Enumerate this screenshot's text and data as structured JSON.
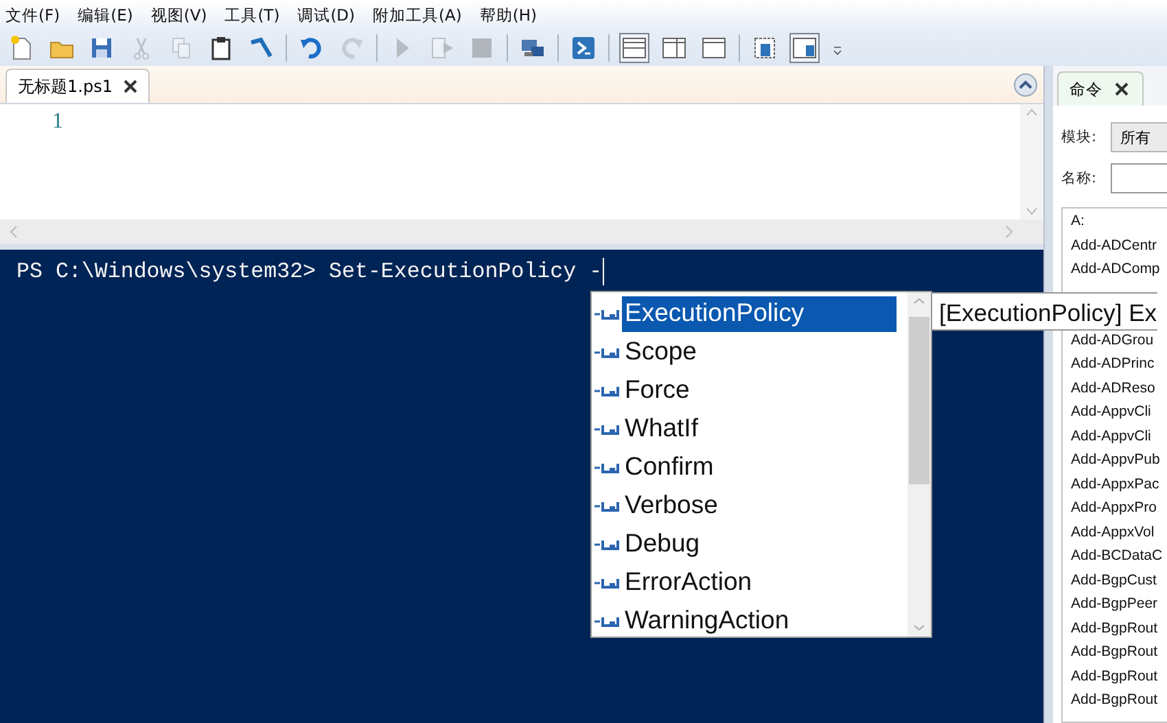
{
  "menu": [
    "文件(F)",
    "编辑(E)",
    "视图(V)",
    "工具(T)",
    "调试(D)",
    "附加工具(A)",
    "帮助(H)"
  ],
  "toolbar": [
    {
      "kind": "new",
      "disabled": false
    },
    {
      "kind": "open",
      "disabled": false
    },
    {
      "kind": "save",
      "disabled": false
    },
    {
      "kind": "cut",
      "disabled": true
    },
    {
      "kind": "copy",
      "disabled": true
    },
    {
      "kind": "paste",
      "disabled": false
    },
    {
      "kind": "clear",
      "disabled": false
    },
    {
      "kind": "separator"
    },
    {
      "kind": "undo",
      "disabled": false
    },
    {
      "kind": "redo",
      "disabled": true
    },
    {
      "kind": "separator"
    },
    {
      "kind": "run",
      "disabled": true
    },
    {
      "kind": "runselection",
      "disabled": true
    },
    {
      "kind": "stop",
      "disabled": true
    },
    {
      "kind": "separator"
    },
    {
      "kind": "remote",
      "disabled": false
    },
    {
      "kind": "separator"
    },
    {
      "kind": "console",
      "disabled": false
    },
    {
      "kind": "separator"
    },
    {
      "kind": "layouttop",
      "selected": true
    },
    {
      "kind": "layoutright",
      "selected": false
    },
    {
      "kind": "layoutmax",
      "selected": false
    },
    {
      "kind": "separator"
    },
    {
      "kind": "scriptpane",
      "selected": false
    },
    {
      "kind": "commandpane",
      "selected": true
    },
    {
      "kind": "overflow"
    }
  ],
  "script_tabs": [
    {
      "label": "无标题1.ps1",
      "selected": true
    }
  ],
  "editor": {
    "line_numbers": [
      "1"
    ]
  },
  "console": {
    "line": "PS C:\\Windows\\system32> Set-ExecutionPolicy -"
  },
  "completion": {
    "items": [
      {
        "label": "ExecutionPolicy",
        "selected": true
      },
      {
        "label": "Scope",
        "selected": false
      },
      {
        "label": "Force",
        "selected": false
      },
      {
        "label": "WhatIf",
        "selected": false
      },
      {
        "label": "Confirm",
        "selected": false
      },
      {
        "label": "Verbose",
        "selected": false
      },
      {
        "label": "Debug",
        "selected": false
      },
      {
        "label": "ErrorAction",
        "selected": false
      },
      {
        "label": "WarningAction",
        "selected": false
      }
    ],
    "tooltip": "[ExecutionPolicy] Ex"
  },
  "commands_panel": {
    "tabs": [
      {
        "label": "命令",
        "selected": true
      }
    ],
    "module_label": "模块:",
    "module_value": "所有",
    "name_label": "名称:",
    "command_groups": [
      [
        "A:",
        "Add-ADCentr",
        "Add-ADComp"
      ],
      [
        "Add-ADGrou",
        "Add-ADPrinc",
        "Add-ADReso",
        "Add-AppvCli",
        "Add-AppvCli",
        "Add-AppvPub",
        "Add-AppxPac",
        "Add-AppxPro",
        "Add-AppxVol",
        "Add-BCDataC",
        "Add-BgpCust",
        "Add-BgpPeer",
        "Add-BgpRout",
        "Add-BgpRout",
        "Add-BgpRout",
        "Add-BgpRout"
      ]
    ]
  }
}
